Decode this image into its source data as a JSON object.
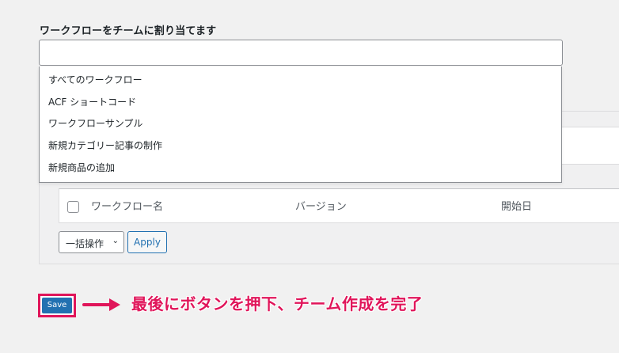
{
  "section": {
    "label": "ワークフローをチームに割り当てます"
  },
  "dropdown": {
    "items": [
      "すべてのワークフロー",
      "ACF ショートコード",
      "ワークフローサンプル",
      "新規カテゴリー記事の制作",
      "新規商品の追加"
    ]
  },
  "table": {
    "headers": [
      "ワークフロー名",
      "バージョン",
      "開始日"
    ]
  },
  "bulk": {
    "select_label": "一括操作",
    "apply_label": "Apply"
  },
  "footer": {
    "save_label": "Save"
  },
  "annotation": {
    "text": "最後にボタンを押下、チーム作成を完了"
  },
  "colors": {
    "accent": "#2271b1",
    "highlight": "#e0155a"
  }
}
